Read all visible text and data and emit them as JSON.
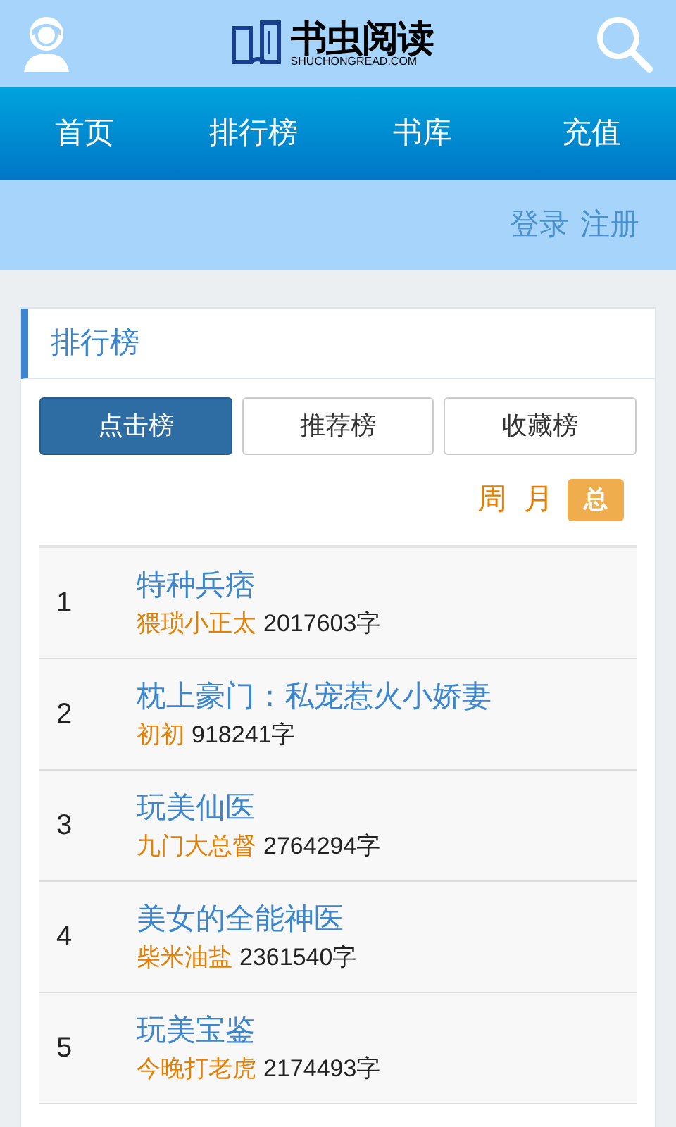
{
  "header": {
    "logo_title": "书虫阅读",
    "logo_subtitle": "SHUCHONGREAD.COM"
  },
  "nav": [
    {
      "label": "首页"
    },
    {
      "label": "排行榜"
    },
    {
      "label": "书库"
    },
    {
      "label": "充值"
    }
  ],
  "account_links": [
    {
      "label": "登录"
    },
    {
      "label": "注册"
    }
  ],
  "panel": {
    "title": "排行榜",
    "tabs": [
      {
        "label": "点击榜",
        "selected": true
      },
      {
        "label": "推荐榜",
        "selected": false
      },
      {
        "label": "收藏榜",
        "selected": false
      }
    ],
    "periods": [
      {
        "label": "周",
        "selected": false
      },
      {
        "label": "月",
        "selected": false
      },
      {
        "label": "总",
        "selected": true
      }
    ],
    "rows": [
      {
        "rank": "1",
        "title": "特种兵痞",
        "author": "猥琐小正太",
        "words": "2017603字"
      },
      {
        "rank": "2",
        "title": "枕上豪门：私宠惹火小娇妻",
        "author": "初初",
        "words": "918241字"
      },
      {
        "rank": "3",
        "title": "玩美仙医",
        "author": "九门大总督",
        "words": "2764294字"
      },
      {
        "rank": "4",
        "title": "美女的全能神医",
        "author": "柴米油盐",
        "words": "2361540字"
      },
      {
        "rank": "5",
        "title": "玩美宝鉴",
        "author": "今晚打老虎",
        "words": "2174493字"
      }
    ]
  }
}
